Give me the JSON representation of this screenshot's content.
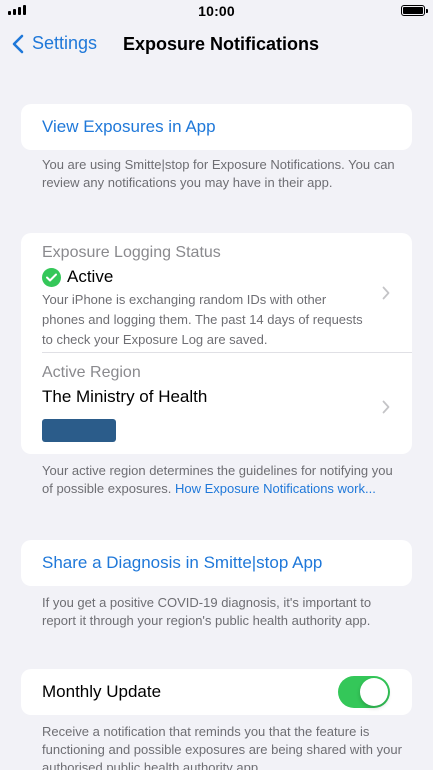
{
  "status_bar": {
    "time": "10:00"
  },
  "nav": {
    "back_label": "Settings",
    "title": "Exposure Notifications"
  },
  "view_exposures": {
    "label": "View Exposures in App",
    "footer": "You are using Smitte|stop for Exposure Notifications. You can review any notifications you may have in their app."
  },
  "logging": {
    "label": "Exposure Logging Status",
    "value": "Active",
    "description": "Your iPhone is exchanging random IDs with other phones and logging them. The past 14 days of requests to check your Exposure Log are saved."
  },
  "region": {
    "label": "Active Region",
    "value": "The Ministry of Health",
    "footer_text": "Your active region determines the guidelines for notifying you of possible exposures. ",
    "footer_link": "How Exposure Notifications work..."
  },
  "share": {
    "label": "Share a Diagnosis in Smitte|stop App",
    "footer": "If you get a positive COVID-19 diagnosis, it's important to report it through your region's public health authority app."
  },
  "monthly": {
    "label": "Monthly Update",
    "enabled": true,
    "footer": "Receive a notification that reminds you that the feature is functioning and possible exposures are being shared with your authorised public health authority app."
  },
  "colors": {
    "accent": "#1f78d9",
    "toggle_on": "#34c759",
    "background": "#f2f2f7"
  }
}
